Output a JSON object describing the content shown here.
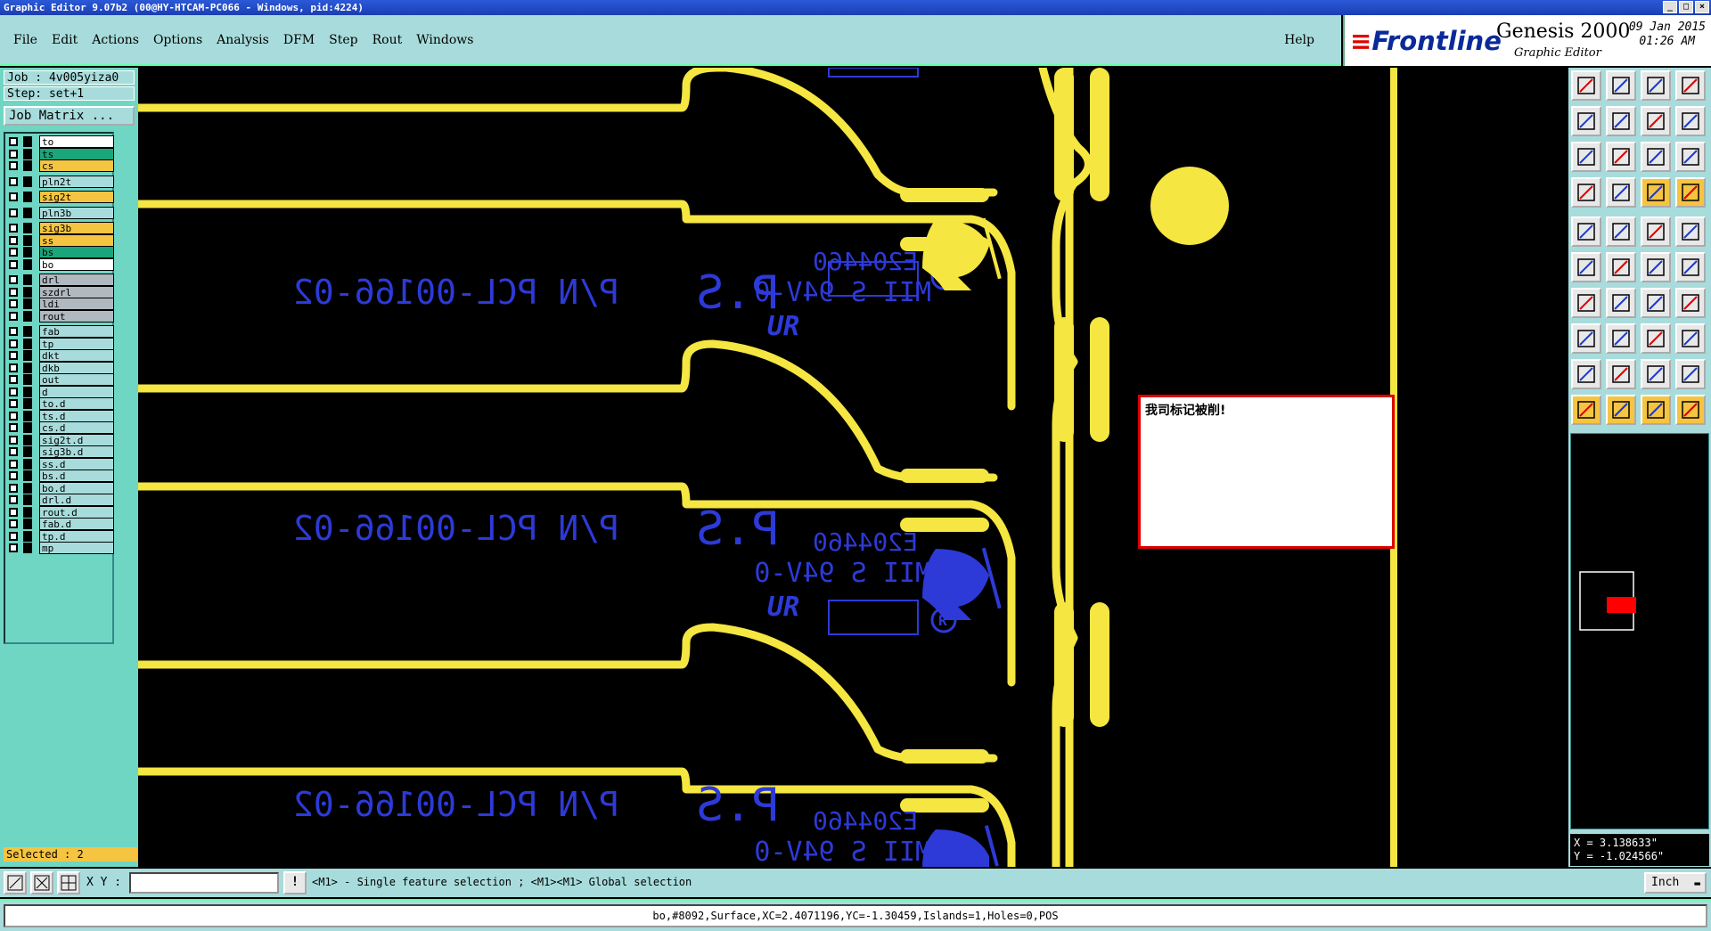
{
  "window": {
    "title": "Graphic Editor 9.07b2 (00@HY-HTCAM-PC066 - Windows, pid:4224)",
    "buttons": [
      "_",
      "□",
      "×"
    ]
  },
  "menu": {
    "items": [
      "File",
      "Edit",
      "Actions",
      "Options",
      "Analysis",
      "DFM",
      "Step",
      "Rout",
      "Windows"
    ],
    "help": "Help"
  },
  "brand": {
    "logo_mark": "≡",
    "logo_text": "Frontline",
    "product": "Genesis 2000",
    "subtitle": "Graphic Editor",
    "date": "09 Jan 2015",
    "time": "01:26 AM"
  },
  "job": {
    "job_label": "Job : 4v005yiza0",
    "step_label": "Step: set+1",
    "matrix_button": "Job Matrix ..."
  },
  "layers": [
    {
      "name": "to",
      "color": "#ffffff"
    },
    {
      "name": "ts",
      "color": "#1aa67a"
    },
    {
      "name": "cs",
      "color": "#f5c440"
    },
    {
      "name": "pln2t",
      "color": "#a8dcdc"
    },
    {
      "name": "sig2t",
      "color": "#f5c440"
    },
    {
      "name": "pln3b",
      "color": "#a8dcdc"
    },
    {
      "name": "sig3b",
      "color": "#f5c440"
    },
    {
      "name": "ss",
      "color": "#f5c440"
    },
    {
      "name": "bs",
      "color": "#1aa67a"
    },
    {
      "name": "bo",
      "color": "#ffffff"
    },
    {
      "name": "drl",
      "color": "#b0b8c0"
    },
    {
      "name": "szdrl",
      "color": "#b0b8c0"
    },
    {
      "name": "ldi",
      "color": "#b0b8c0"
    },
    {
      "name": "rout",
      "color": "#b0b8c0"
    },
    {
      "name": "fab",
      "color": "#a8dcdc"
    },
    {
      "name": "tp",
      "color": "#a8dcdc"
    },
    {
      "name": "dkt",
      "color": "#a8dcdc"
    },
    {
      "name": "dkb",
      "color": "#a8dcdc"
    },
    {
      "name": "out",
      "color": "#a8dcdc"
    },
    {
      "name": "d",
      "color": "#a8dcdc"
    },
    {
      "name": "to.d",
      "color": "#a8dcdc"
    },
    {
      "name": "ts.d",
      "color": "#a8dcdc"
    },
    {
      "name": "cs.d",
      "color": "#a8dcdc"
    },
    {
      "name": "sig2t.d",
      "color": "#a8dcdc"
    },
    {
      "name": "sig3b.d",
      "color": "#a8dcdc"
    },
    {
      "name": "ss.d",
      "color": "#a8dcdc"
    },
    {
      "name": "bs.d",
      "color": "#a8dcdc"
    },
    {
      "name": "bo.d",
      "color": "#a8dcdc"
    },
    {
      "name": "drl.d",
      "color": "#a8dcdc"
    },
    {
      "name": "rout.d",
      "color": "#a8dcdc"
    },
    {
      "name": "fab.d",
      "color": "#a8dcdc"
    },
    {
      "name": "tp.d",
      "color": "#a8dcdc"
    },
    {
      "name": "mp",
      "color": "#a8dcdc"
    }
  ],
  "selected_label": "Selected : 2",
  "board": {
    "part_number": "P/N PCL-00166-02",
    "rev": "P.S",
    "code": "E204460",
    "grade": "MII S 94V-0",
    "ul_mark": "UR",
    "reg_mark": "R"
  },
  "popup": {
    "message": "我司标记被削!"
  },
  "coords": {
    "x": "X = 3.138633\"",
    "y": "Y = -1.024566\""
  },
  "bottombar": {
    "xy_label": "X Y :",
    "xy_value": "",
    "hint_icon": "!",
    "hint": "<M1> - Single feature selection ; <M1><M1> Global selection",
    "unit": "Inch"
  },
  "status": "bo,#8092,Surface,XC=2.4071196,YC=-1.30459,Islands=1,Holes=0,POS",
  "colors": {
    "copper": "#f5e641",
    "silkscreen": "#2d3ad8",
    "panel": "#a8dcdc",
    "highlight": "#f5c440",
    "popup_border": "#dd0000"
  }
}
